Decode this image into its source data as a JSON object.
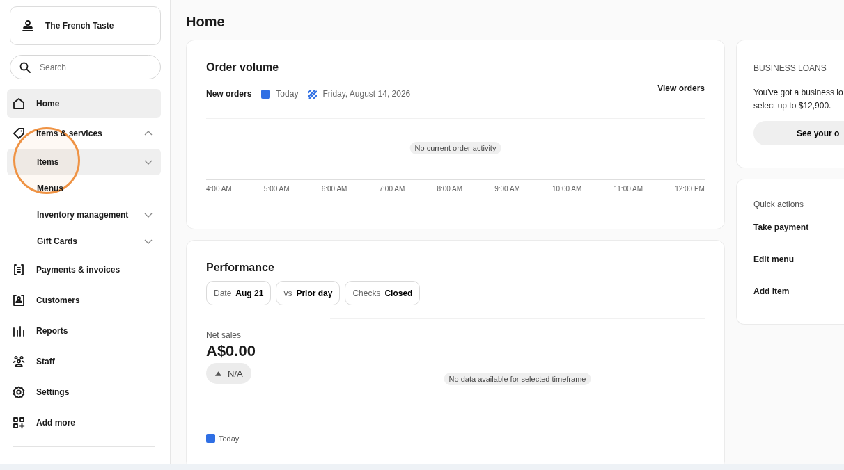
{
  "business": {
    "name": "The French Taste"
  },
  "search": {
    "placeholder": "Search"
  },
  "nav": [
    {
      "label": "Home",
      "selected": true
    },
    {
      "label": "Items & services",
      "selected": false,
      "expanded": true,
      "children": [
        {
          "label": "Items",
          "selected": true,
          "expanded": false
        },
        {
          "label": "Menus",
          "selected": false
        },
        {
          "label": "Inventory management",
          "selected": false,
          "expanded": false
        },
        {
          "label": "Gift Cards",
          "selected": false,
          "expanded": false
        }
      ]
    },
    {
      "label": "Payments & invoices",
      "selected": false
    },
    {
      "label": "Customers",
      "selected": false
    },
    {
      "label": "Reports",
      "selected": false
    },
    {
      "label": "Staff",
      "selected": false
    },
    {
      "label": "Settings",
      "selected": false
    },
    {
      "label": "Add more",
      "selected": false
    }
  ],
  "page_title": "Home",
  "order_volume": {
    "title": "Order volume",
    "legend_title": "New orders",
    "legend": [
      {
        "label": "Today",
        "kind": "solid"
      },
      {
        "label": "Friday, August 14, 2026",
        "kind": "hatched"
      }
    ],
    "link": "View orders",
    "empty_message": "No current order activity",
    "x_labels": [
      "4:00 AM",
      "5:00 AM",
      "6:00 AM",
      "7:00 AM",
      "8:00 AM",
      "9:00 AM",
      "10:00 AM",
      "11:00 AM",
      "12:00 PM"
    ]
  },
  "performance": {
    "title": "Performance",
    "filters": [
      {
        "label": "Date",
        "value": "Aug 21"
      },
      {
        "label": "vs",
        "value": "Prior day"
      },
      {
        "label": "Checks",
        "value": "Closed"
      }
    ],
    "metric_label": "Net sales",
    "metric_value": "A$0.00",
    "change": "N/A",
    "empty_message": "No data available for selected timeframe",
    "legend": [
      {
        "label": "Today",
        "kind": "solid"
      }
    ]
  },
  "business_loans": {
    "heading": "BUSINESS LOANS",
    "lines": [
      "You've got a business lo",
      "select up to $12,900."
    ],
    "button": "See your o"
  },
  "quick_actions": {
    "heading": "Quick actions",
    "items": [
      "Take payment",
      "Edit menu",
      "Add item"
    ]
  }
}
